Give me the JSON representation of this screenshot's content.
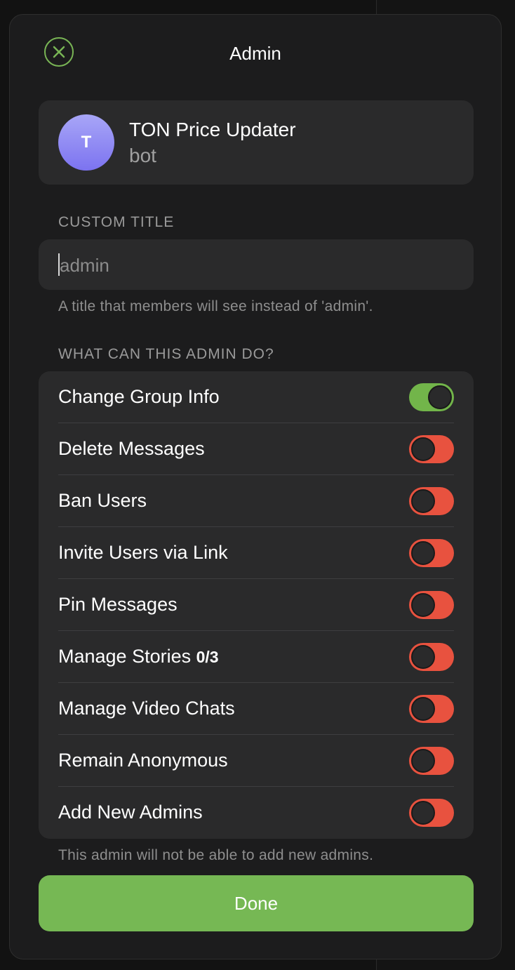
{
  "modal": {
    "title": "Admin",
    "close_icon": "close-circle-icon",
    "accent_color": "#76b854"
  },
  "user": {
    "avatar_initial": "T",
    "name": "TON Price Updater",
    "subtitle": "bot"
  },
  "custom_title": {
    "section_label": "CUSTOM TITLE",
    "value": "",
    "placeholder": "admin",
    "hint": "A title that members will see instead of 'admin'."
  },
  "permissions": {
    "section_label": "WHAT CAN THIS ADMIN DO?",
    "items": [
      {
        "label": "Change Group Info",
        "count": "",
        "enabled": true
      },
      {
        "label": "Delete Messages",
        "count": "",
        "enabled": false
      },
      {
        "label": "Ban Users",
        "count": "",
        "enabled": false
      },
      {
        "label": "Invite Users via Link",
        "count": "",
        "enabled": false
      },
      {
        "label": "Pin Messages",
        "count": "",
        "enabled": false
      },
      {
        "label": "Manage Stories",
        "count": "0/3",
        "enabled": false
      },
      {
        "label": "Manage Video Chats",
        "count": "",
        "enabled": false
      },
      {
        "label": "Remain Anonymous",
        "count": "",
        "enabled": false
      },
      {
        "label": "Add New Admins",
        "count": "",
        "enabled": false
      }
    ],
    "footer_hint": "This admin will not be able to add new admins.",
    "toggle_on_color": "#72b54a",
    "toggle_off_color": "#e8523f"
  },
  "actions": {
    "done_label": "Done"
  }
}
